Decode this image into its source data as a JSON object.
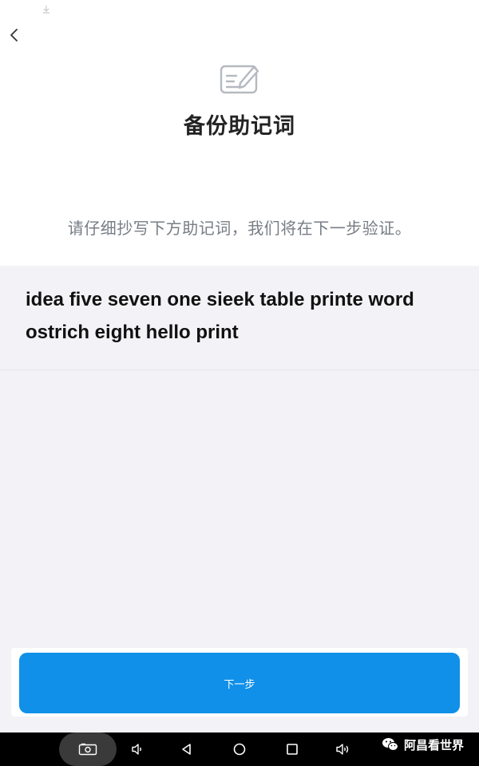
{
  "header": {
    "title": "备份助记词",
    "back_icon": "chevron-left-icon",
    "title_icon": "edit-document-icon"
  },
  "instruction": "请仔细抄写下方助记词，我们将在下一步验证。",
  "mnemonic": {
    "phrase": "idea five seven one sieek table printe word ostrich eight hello print"
  },
  "footer": {
    "next_label": "下一步"
  },
  "navbar": {
    "icons": [
      "screenshot-icon",
      "volume-down-icon",
      "back-triangle-icon",
      "home-circle-icon",
      "recents-square-icon",
      "volume-up-icon"
    ]
  },
  "watermark": {
    "text": "阿昌看世界",
    "icon": "wechat-icon"
  },
  "colors": {
    "accent": "#1090e8",
    "background_gray": "#f3f3f7",
    "instruction_text": "#777d85"
  }
}
